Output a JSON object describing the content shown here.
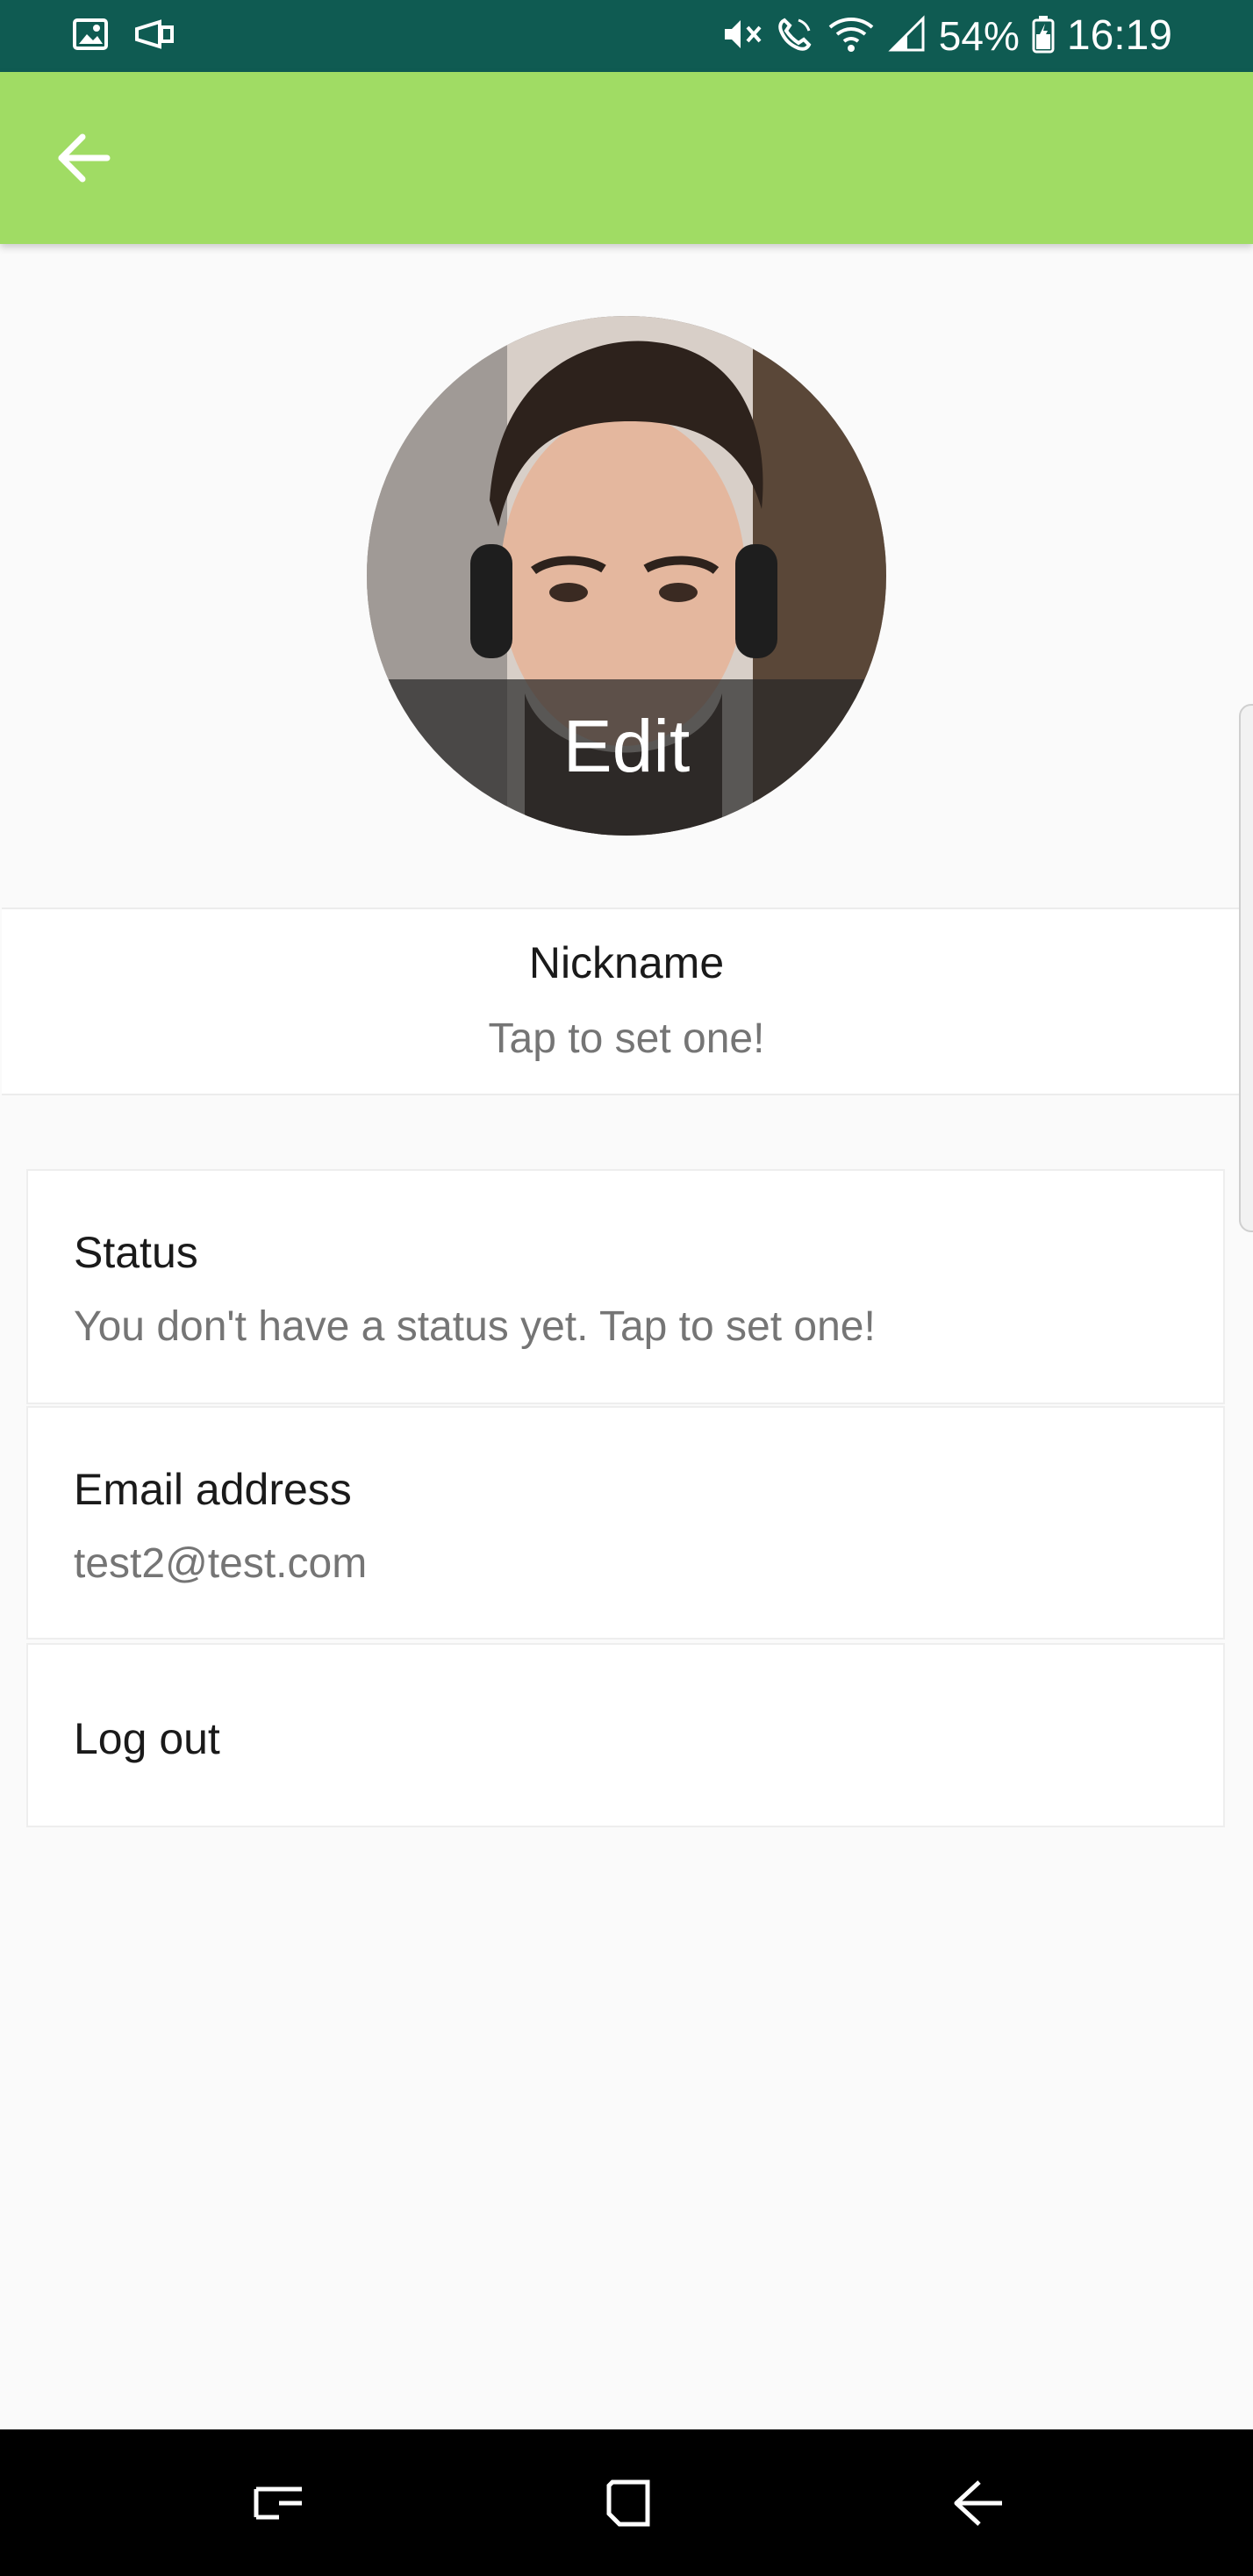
{
  "status_bar": {
    "battery": "54%",
    "time": "16:19",
    "icons_left": [
      "gallery-icon",
      "cast-icon"
    ],
    "icons_right": [
      "mute-icon",
      "volte-call-icon",
      "wifi-icon",
      "signal-icon",
      "battery-icon"
    ],
    "background": "#0f5b52"
  },
  "app_bar": {
    "back_icon": "arrow-back-icon",
    "background": "#a0dc64"
  },
  "profile": {
    "edit_label": "Edit"
  },
  "nickname": {
    "title": "Nickname",
    "hint": "Tap to set one!"
  },
  "settings": {
    "status": {
      "title": "Status",
      "value": "You don't have a status yet. Tap to set one!"
    },
    "email": {
      "title": "Email address",
      "value": "test2@test.com"
    },
    "logout": {
      "label": "Log out"
    }
  },
  "nav_bar": {
    "buttons": [
      "recents-icon",
      "home-icon",
      "back-icon"
    ]
  }
}
